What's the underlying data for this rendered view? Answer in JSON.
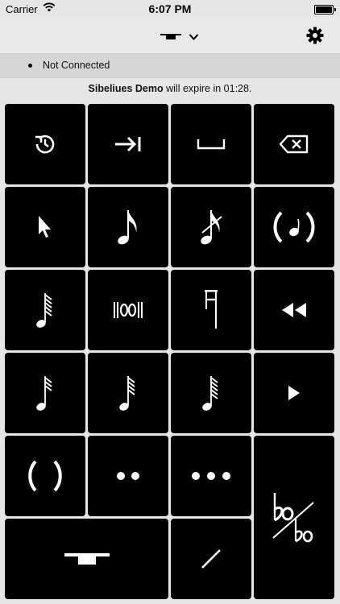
{
  "status_bar": {
    "carrier": "Carrier",
    "time": "6:07 PM"
  },
  "nav": {
    "title_icon": "tenuto-icon",
    "chevron": "chevron-down-icon",
    "settings_icon": "gear-icon"
  },
  "connection": {
    "text": "Not Connected"
  },
  "demo": {
    "product": "Sibeliues Demo",
    "message": "will expire in 01:28."
  },
  "keys": [
    {
      "icon": "undo-icon"
    },
    {
      "icon": "tab-icon"
    },
    {
      "icon": "space-icon"
    },
    {
      "icon": "backspace-icon"
    },
    {
      "icon": "pointer-icon"
    },
    {
      "icon": "eighth-note-icon"
    },
    {
      "icon": "acciaccatura-icon"
    },
    {
      "icon": "fermata-paren-icon"
    },
    {
      "icon": "tremolo-four-icon"
    },
    {
      "icon": "repeat-bar-icon"
    },
    {
      "icon": "stem-flag-icon"
    },
    {
      "icon": "rewind-icon"
    },
    {
      "icon": "tremolo-two-icon"
    },
    {
      "icon": "tremolo-three-icon"
    },
    {
      "icon": "tremolo-five-icon"
    },
    {
      "icon": "play-icon"
    },
    {
      "icon": "parentheses-icon"
    },
    {
      "icon": "two-dots-icon"
    },
    {
      "icon": "three-dots-icon"
    },
    {
      "icon": "flat-flat-icon"
    },
    {
      "icon": "tenuto-wide-icon"
    },
    {
      "icon": "slash-icon"
    }
  ],
  "colors": {
    "key_bg": "#000000",
    "key_fg": "#ffffff",
    "background": "#e6e6e6"
  }
}
